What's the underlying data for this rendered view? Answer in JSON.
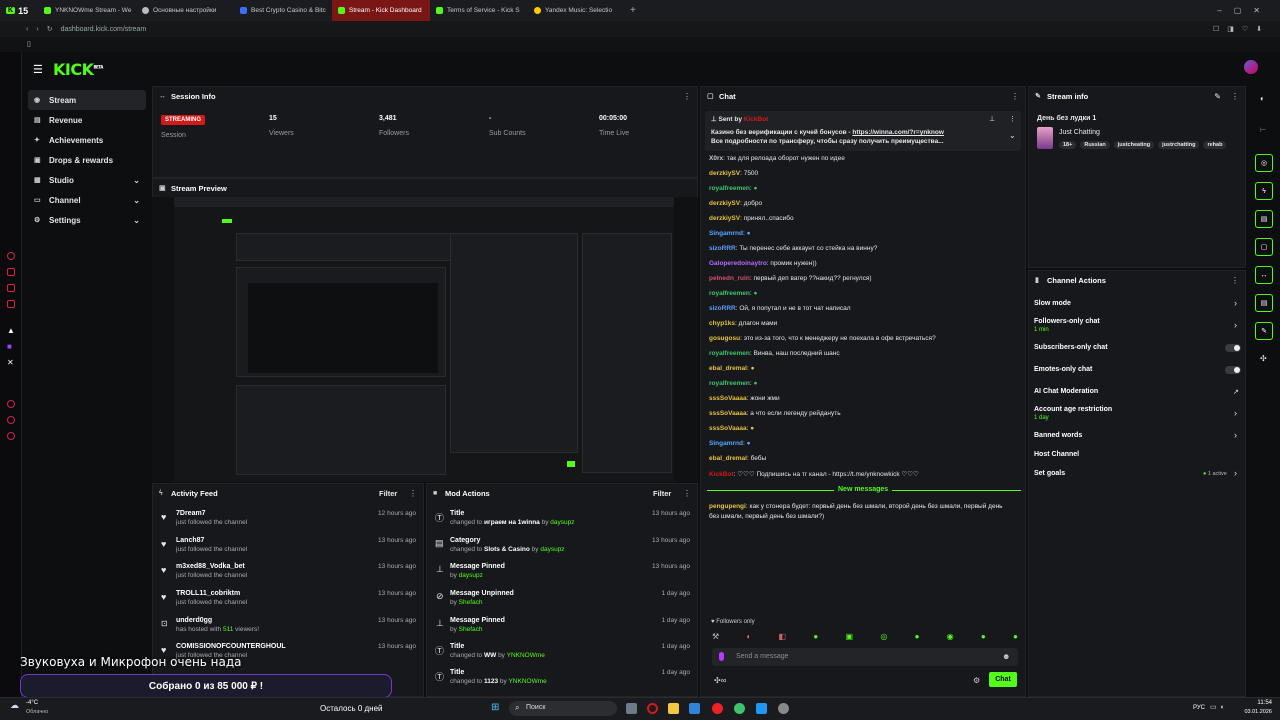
{
  "browser": {
    "tabs": [
      {
        "label": "YNKNOWme Stream - We"
      },
      {
        "label": "Основные настройки"
      },
      {
        "label": "Best Crypto Casino & Bitc"
      },
      {
        "label": "Stream - Kick Dashboard"
      },
      {
        "label": "Terms of Service - Kick S"
      },
      {
        "label": "Yandex Music: Selectio"
      }
    ],
    "tab_count": "15",
    "url": "dashboard.kick.com/stream"
  },
  "brand": {
    "logo": "KICK",
    "beta": "BETA",
    "accent": "#53fc18"
  },
  "nav": {
    "items": [
      {
        "label": "Stream"
      },
      {
        "label": "Revenue"
      },
      {
        "label": "Achievements"
      },
      {
        "label": "Drops & rewards"
      },
      {
        "label": "Studio"
      },
      {
        "label": "Channel"
      },
      {
        "label": "Settings"
      }
    ]
  },
  "session": {
    "title": "Session Info",
    "badge": "STREAMING",
    "session_label": "Session",
    "stats": [
      {
        "value": "15",
        "label": "Viewers"
      },
      {
        "value": "3,481",
        "label": "Followers"
      },
      {
        "value": "-",
        "label": "Sub Counts"
      },
      {
        "value": "00:05:00",
        "label": "Time Live"
      }
    ]
  },
  "preview": {
    "title": "Stream Preview"
  },
  "activity": {
    "title": "Activity Feed",
    "filter": "Filter",
    "items": [
      {
        "name": "7Dream7",
        "desc": "just followed the channel",
        "ago": "12 hours ago"
      },
      {
        "name": "Lanch87",
        "desc": "just followed the channel",
        "ago": "13 hours ago"
      },
      {
        "name": "m3xed88_Vodka_bet",
        "desc": "just followed the channel",
        "ago": "13 hours ago"
      },
      {
        "name": "TROLL11_cobriktm",
        "desc": "just followed the channel",
        "ago": "13 hours ago"
      },
      {
        "name": "underd0gg",
        "desc_pre": "has hosted with ",
        "desc_num": "511",
        "desc_post": " viewers!",
        "ago": "13 hours ago"
      },
      {
        "name": "COMISSIONOFCOUNTERGHOUL",
        "desc": "just followed the channel",
        "ago": "13 hours ago"
      }
    ]
  },
  "mod": {
    "title": "Mod Actions",
    "filter": "Filter",
    "items": [
      {
        "name": "Title",
        "pre": "changed to ",
        "val": "играем на 1winna",
        "by": "daysupz",
        "ago": "13 hours ago"
      },
      {
        "name": "Category",
        "pre": "changed to ",
        "val": "Slots & Casino",
        "by": "daysupz",
        "ago": "13 hours ago"
      },
      {
        "name": "Message Pinned",
        "pre": "",
        "val": "",
        "by": "daysupz",
        "ago": "13 hours ago"
      },
      {
        "name": "Message Unpinned",
        "pre": "",
        "val": "",
        "by": "Shefach",
        "ago": "1 day ago"
      },
      {
        "name": "Message Pinned",
        "pre": "",
        "val": "",
        "by": "Shefach",
        "ago": "1 day ago"
      },
      {
        "name": "Title",
        "pre": "changed to ",
        "val": "WW",
        "by": "YNKNOWme",
        "ago": "1 day ago"
      },
      {
        "name": "Title",
        "pre": "changed to ",
        "val": "1123",
        "by": "YNKNOWme",
        "ago": "1 day ago"
      }
    ]
  },
  "chat": {
    "title": "Chat",
    "pinned_by_label": "Sent by",
    "pinned_by": "KickBot",
    "pinned_line1": "Казино без верификации с кучей бонусов - ",
    "pinned_link": "https://winna.com/?r=ynknow",
    "pinned_line2": "Все подробности по трансферу, чтобы сразу получить преимущества...",
    "messages": [
      {
        "user": "X0rx",
        "color": "#c9c9c9",
        "text": "так для релоада оборот нужен по идее"
      },
      {
        "user": "derzkiySV",
        "color": "#e6c33a",
        "text": "7500"
      },
      {
        "user": "royalfreemen",
        "color": "#3ec46d",
        "text": ""
      },
      {
        "user": "derzkiySV",
        "color": "#e6c33a",
        "text": "добро"
      },
      {
        "user": "derzkiySV",
        "color": "#e6c33a",
        "text": "принял..спасибо"
      },
      {
        "user": "Singamrnd",
        "color": "#53a8ff",
        "text": ""
      },
      {
        "user": "sizoRRR",
        "color": "#5aa0ff",
        "text": "Ты перенес себе аккаунт со стейка на винну?"
      },
      {
        "user": "Galoperedoinaytro",
        "color": "#b66bff",
        "text": "промик нужен))"
      },
      {
        "user": "pelnedn_ruin",
        "color": "#d4506a",
        "text": "первый деп вагер ??накид?? регнулся)"
      },
      {
        "user": "royalfreemen",
        "color": "#3ec46d",
        "text": ""
      },
      {
        "user": "sizoRRR",
        "color": "#5aa0ff",
        "text": "Ой, я попутал и не в тот чат написал"
      },
      {
        "user": "chyp1ks",
        "color": "#e6c33a",
        "text": "длагон мами"
      },
      {
        "user": "gosugosu",
        "color": "#e6c33a",
        "text": "это из-за того, что к менеджеру не поехала в офе встречаться?"
      },
      {
        "user": "royalfreemen",
        "color": "#3ec46d",
        "text": "Винва, наш последний шанс"
      },
      {
        "user": "ebal_dremal",
        "color": "#e6c33a",
        "text": ""
      },
      {
        "user": "royalfreemen",
        "color": "#3ec46d",
        "text": ""
      },
      {
        "user": "sssSoVaaaa",
        "color": "#e6c33a",
        "text": "жони жми"
      },
      {
        "user": "sssSoVaaaa",
        "color": "#e6c33a",
        "text": "а что если легенду рейдануть"
      },
      {
        "user": "sssSoVaaaa",
        "color": "#e6c33a",
        "text": ""
      },
      {
        "user": "Singamrnd",
        "color": "#53a8ff",
        "text": ""
      },
      {
        "user": "ebal_dremal",
        "color": "#e6c33a",
        "text": "бебы"
      },
      {
        "user": "KickBot",
        "color": "#d11a1a",
        "text": "♡♡♡ Подпишись на тг канал - https://t.me/ynknowkick ♡♡♡"
      }
    ],
    "new_messages": "New messages",
    "last_user": "pengupengi",
    "last_text": "как у стонера будет: первый день без шмали, второй день без шмали, первый день без шмали, первый день без шмали?)",
    "followers_only": "Followers only",
    "placeholder": "Send a message",
    "send": "Chat"
  },
  "stream_info": {
    "title": "Stream info",
    "stream_title": "День без лудки 1",
    "category": "Just Chatting",
    "tags": [
      "18+",
      "Russian",
      "justcheating",
      "justrchatting",
      "rehab"
    ]
  },
  "actions": {
    "title": "Channel Actions",
    "slow_mode": "Slow mode",
    "followers_chat": "Followers-only chat",
    "followers_sub": "1 min",
    "subs_chat": "Subscribers-only chat",
    "emotes_chat": "Emotes-only chat",
    "ai_mod": "AI Chat Moderation",
    "age_restrict": "Account age restriction",
    "age_sub": "1 day",
    "banned": "Banned words",
    "host": "Host Channel",
    "goals": "Set goals",
    "goals_active": "1 active"
  },
  "overlay": {
    "headline": "Звуковуха и Микрофон очень нада",
    "collected": "Собрано 0  из 85 000 ₽ !"
  },
  "taskbar": {
    "weather_temp": "-4°C",
    "weather_desc": "Облачно",
    "countdown": "Осталось 0 дней",
    "search": "Поиск",
    "lang": "РУС",
    "time": "11:54",
    "date": "03.01.2026"
  }
}
